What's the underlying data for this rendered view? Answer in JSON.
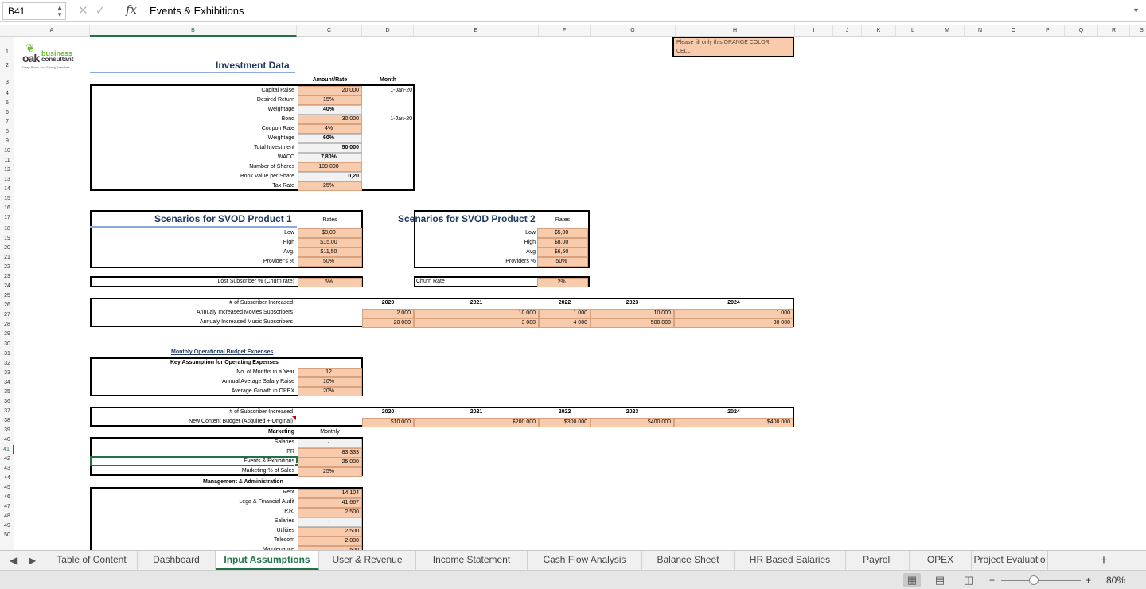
{
  "formula_bar": {
    "cell_ref": "B41",
    "fx_label": "fx",
    "formula": "Events & Exhibitions"
  },
  "columns": [
    "A",
    "B",
    "C",
    "D",
    "E",
    "F",
    "G",
    "H",
    "I",
    "J",
    "K",
    "L",
    "M",
    "N",
    "O",
    "P",
    "Q",
    "R",
    "S"
  ],
  "selected_column": "B",
  "selected_row": "41",
  "rows": [
    "1",
    "2",
    "3",
    "4",
    "5",
    "6",
    "7",
    "8",
    "9",
    "10",
    "11",
    "12",
    "13",
    "14",
    "15",
    "16",
    "17",
    "18",
    "19",
    "20",
    "21",
    "22",
    "23",
    "24",
    "25",
    "26",
    "27",
    "28",
    "29",
    "30",
    "31",
    "32",
    "33",
    "34",
    "35",
    "36",
    "37",
    "38",
    "39",
    "40",
    "41",
    "42",
    "43",
    "44",
    "45",
    "46",
    "47",
    "48",
    "49",
    "50"
  ],
  "logo": {
    "line1": "business",
    "line2": "consultant",
    "mark": "oak",
    "tagline": "Deep Roots and Strong Branches"
  },
  "note": {
    "line1": "Please fill only this ORANGE COLOR",
    "line2": "CELL"
  },
  "investment": {
    "title": "Investment Data",
    "col_amount": "Amount/Rate",
    "col_month": "Month",
    "items": [
      {
        "label": "Capital Raise",
        "value": "20 000",
        "month": "1-Jan-20",
        "style": "or",
        "align": "r"
      },
      {
        "label": "Desired Return",
        "value": "15%",
        "month": "",
        "style": "or",
        "align": "c"
      },
      {
        "label": "Weightage",
        "value": "40%",
        "month": "",
        "style": "gr",
        "align": "c",
        "bold": true
      },
      {
        "label": "Bond",
        "value": "30 000",
        "month": "1-Jan-20",
        "style": "or",
        "align": "r"
      },
      {
        "label": "Coupon Rate",
        "value": "4%",
        "month": "",
        "style": "or",
        "align": "c"
      },
      {
        "label": "Weightage",
        "value": "60%",
        "month": "",
        "style": "gr",
        "align": "c",
        "bold": true
      },
      {
        "label": "Total Investment",
        "value": "50 000",
        "month": "",
        "style": "gr",
        "align": "r",
        "bold": true
      },
      {
        "label": "WACC",
        "value": "7,80%",
        "month": "",
        "style": "gr",
        "align": "c",
        "bold": true
      },
      {
        "label": "Number of Shares",
        "value": "100 000",
        "month": "",
        "style": "or",
        "align": "c"
      },
      {
        "label": "Book Value per Share",
        "value": "0,20",
        "month": "",
        "style": "gr",
        "align": "r",
        "bold": true
      },
      {
        "label": "Tax Rate",
        "value": "25%",
        "month": "",
        "style": "or",
        "align": "c"
      }
    ]
  },
  "svod1": {
    "title": "Scenarios for SVOD Product 1",
    "rates_label": "Rates",
    "items": [
      {
        "label": "Low",
        "value": "$8,00"
      },
      {
        "label": "High",
        "value": "$15,00"
      },
      {
        "label": "Avg.",
        "value": "$11,50"
      },
      {
        "label": "Provider's %",
        "value": "50%"
      }
    ],
    "churn_label": "Lost Subscriber % (Churn rate)",
    "churn_value": "5%"
  },
  "svod2": {
    "title": "Scenarios for SVOD Product 2",
    "rates_label": "Rates",
    "items": [
      {
        "label": "Low",
        "value": "$5,00"
      },
      {
        "label": "High",
        "value": "$8,00"
      },
      {
        "label": "Avg",
        "value": "$6,50"
      },
      {
        "label": "Providers %",
        "value": "50%"
      }
    ],
    "churn_label": "Churn Rate",
    "churn_value": "2%"
  },
  "subscribers": {
    "header_label": "# of Subscriber Increased",
    "years": [
      "2020",
      "2021",
      "2022",
      "2023",
      "2024"
    ],
    "movies_label": "Annualy Increased Movies Subscribers",
    "movies": [
      "2 000",
      "10 000",
      "1 000",
      "10 000",
      "1 000"
    ],
    "music_label": "Annualy Increased Music Subscribers",
    "music": [
      "20 000",
      "3 000",
      "4 000",
      "500 000",
      "80 000"
    ]
  },
  "opex": {
    "title": "Monthly Operational Budget Expenses",
    "subtitle": "Key Assumption for Operating Expenses",
    "items": [
      {
        "label": "No. of Months in a Year",
        "value": "12"
      },
      {
        "label": "Annual Average Salary Raise",
        "value": "10%"
      },
      {
        "label": "Average Growth in OPEX",
        "value": "20%"
      }
    ]
  },
  "content": {
    "header_label": "# of Subscriber Increased",
    "years": [
      "2020",
      "2021",
      "2022",
      "2023",
      "2024"
    ],
    "budget_label": "New Content Budget (Acquired + Original)",
    "budget": [
      "$10 000",
      "$200 000",
      "$300 000",
      "$400 000",
      "$400 000"
    ]
  },
  "marketing": {
    "title": "Marketing",
    "monthly_label": "Monthly",
    "items": [
      {
        "label": "Salaries",
        "value": "-",
        "style": "gr"
      },
      {
        "label": "PR",
        "value": "83 333",
        "style": "or"
      },
      {
        "label": "Events & Exhibitions",
        "value": "25 000",
        "style": "or"
      },
      {
        "label": "Marketing % of Sales",
        "value": "25%",
        "style": "or"
      }
    ]
  },
  "management": {
    "title": "Management & Administration",
    "items": [
      {
        "label": "Rent",
        "value": "14 104",
        "style": "or"
      },
      {
        "label": "Lega & Financial Audit",
        "value": "41 667",
        "style": "or"
      },
      {
        "label": "P.R.",
        "value": "2 500",
        "style": "or"
      },
      {
        "label": "Salaries",
        "value": "-",
        "style": "gr"
      },
      {
        "label": "Utilities",
        "value": "2 500",
        "style": "or"
      },
      {
        "label": "Telecom",
        "value": "2 000",
        "style": "or"
      },
      {
        "label": "Maintenance",
        "value": "500",
        "style": "or"
      }
    ]
  },
  "tabs": [
    {
      "label": "Table of Content"
    },
    {
      "label": "Dashboard"
    },
    {
      "label": "Input Assumptions",
      "active": true
    },
    {
      "label": "User & Revenue"
    },
    {
      "label": "Income Statement"
    },
    {
      "label": "Cash Flow Analysis"
    },
    {
      "label": "Balance Sheet"
    },
    {
      "label": "HR Based Salaries"
    },
    {
      "label": "Payroll"
    },
    {
      "label": "OPEX"
    },
    {
      "label": "Project Evaluatio"
    }
  ],
  "add_tab": "+",
  "status": {
    "zoom": "80%",
    "zoom_minus": "−",
    "zoom_plus": "+"
  }
}
